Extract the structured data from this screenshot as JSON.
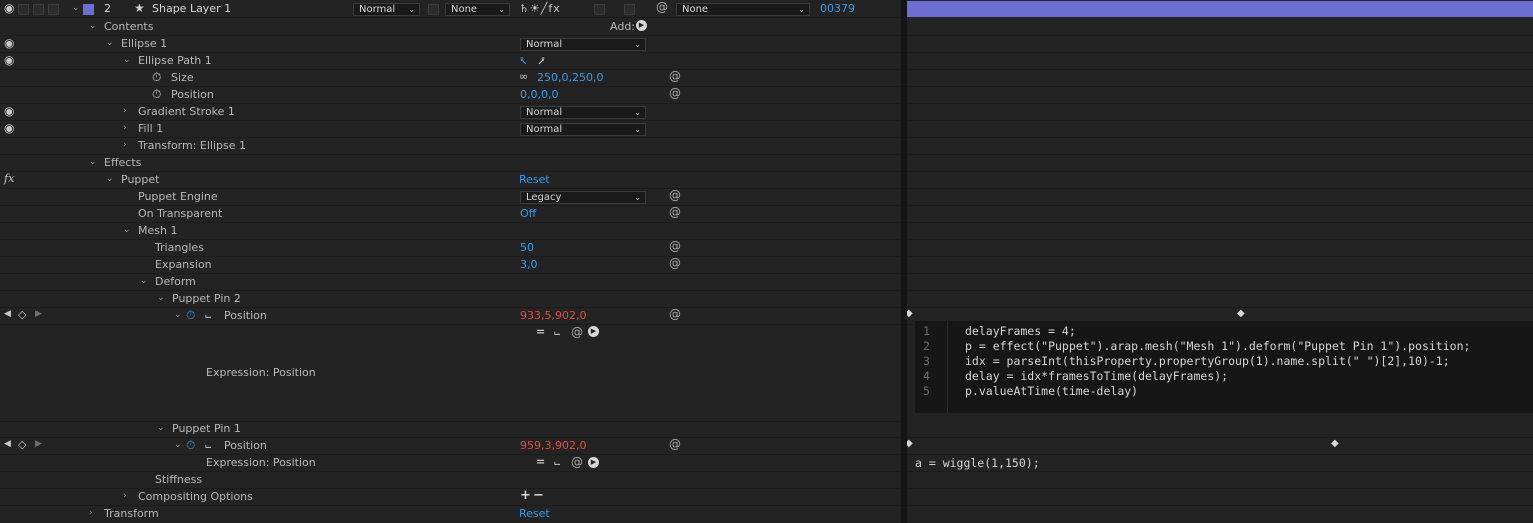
{
  "layer": {
    "number": "2",
    "name": "Shape Layer 1",
    "mode": "Normal",
    "trkmat": "None",
    "switches": "♄☀╱fx",
    "parent": "None",
    "stretch": "00379",
    "color": "#6c6fd1"
  },
  "contents": {
    "label": "Contents",
    "add_label": "Add:",
    "ellipse1": {
      "label": "Ellipse 1",
      "mode": "Normal"
    },
    "ellipse_path1": {
      "label": "Ellipse Path 1"
    },
    "size": {
      "label": "Size",
      "value": "250,0,250,0"
    },
    "position": {
      "label": "Position",
      "value": "0,0,0,0"
    },
    "gradient_stroke": {
      "label": "Gradient Stroke 1",
      "mode": "Normal"
    },
    "fill1": {
      "label": "Fill 1",
      "mode": "Normal"
    },
    "transform_ellipse": {
      "label": "Transform: Ellipse 1"
    }
  },
  "effects": {
    "label": "Effects",
    "fx_label": "fx",
    "puppet": {
      "label": "Puppet",
      "reset": "Reset"
    },
    "puppet_engine": {
      "label": "Puppet Engine",
      "value": "Legacy"
    },
    "on_transparent": {
      "label": "On Transparent",
      "value": "Off"
    },
    "mesh1": {
      "label": "Mesh 1"
    },
    "triangles": {
      "label": "Triangles",
      "value": "50"
    },
    "expansion": {
      "label": "Expansion",
      "value": "3,0"
    },
    "deform": {
      "label": "Deform"
    },
    "pin2": {
      "label": "Puppet Pin 2",
      "position_label": "Position",
      "position_value": "933,5,902,0",
      "expression_label": "Expression: Position"
    },
    "pin1": {
      "label": "Puppet Pin 1",
      "position_label": "Position",
      "position_value": "959,3,902,0",
      "expression_label": "Expression: Position"
    },
    "stiffness": {
      "label": "Stiffness"
    },
    "compositing": {
      "label": "Compositing Options",
      "plus": "+",
      "minus": "−"
    }
  },
  "transform": {
    "label": "Transform",
    "reset": "Reset"
  },
  "timeline": {
    "expression1_lines": [
      {
        "n": "1",
        "code": "delayFrames = 4;"
      },
      {
        "n": "2",
        "code": "p = effect(\"Puppet\").arap.mesh(\"Mesh 1\").deform(\"Puppet Pin 1\").position;"
      },
      {
        "n": "3",
        "code": "idx = parseInt(thisProperty.propertyGroup(1).name.split(\" \")[2],10)-1;"
      },
      {
        "n": "4",
        "code": "delay = idx*framesToTime(delayFrames);"
      },
      {
        "n": "5",
        "code": "p.valueAtTime(time-delay)"
      }
    ],
    "expression2": "a = wiggle(1,150);"
  },
  "icons": {
    "eye": "eye-icon",
    "stopwatch": "stopwatch-icon",
    "graph": "graph-icon",
    "spiral": "expression-spiral-icon",
    "keyframe": "keyframe-icon"
  },
  "colors": {
    "value_blue": "#3a9be8",
    "value_red": "#e0513e",
    "layer_bar": "#6c6fd1"
  }
}
